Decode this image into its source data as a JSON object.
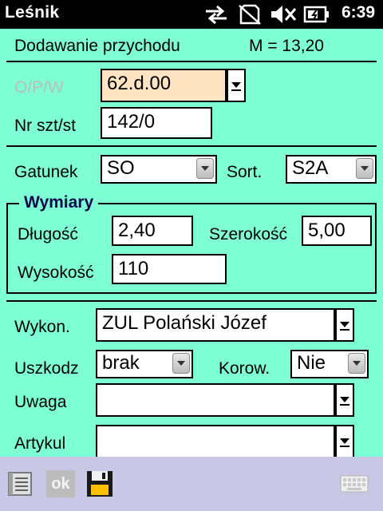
{
  "status_bar": {
    "app_title": "Leśnik",
    "time": "6:39",
    "icons": [
      "sync-arrows-icon",
      "no-sim-icon",
      "speaker-muted-icon",
      "battery-charging-icon"
    ]
  },
  "header": {
    "title": "Dodawanie przychodu",
    "measure": "M = 13,20"
  },
  "fields": {
    "opw": {
      "label": "O/P/W",
      "value": "62.d.00"
    },
    "nr": {
      "label": "Nr szt/st",
      "value": "142/0"
    },
    "gatunek": {
      "label": "Gatunek",
      "value": "SO"
    },
    "sort": {
      "label": "Sort.",
      "value": "S2A"
    },
    "wymiary": {
      "title": "Wymiary",
      "dlugosc": {
        "label": "Długość",
        "value": "2,40"
      },
      "szerokosc": {
        "label": "Szerokość",
        "value": "5,00"
      },
      "wysokosc": {
        "label": "Wysokość",
        "value": "110"
      }
    },
    "wykon": {
      "label": "Wykon.",
      "value": "ZUL Polański Józef"
    },
    "uszkodz": {
      "label": "Uszkodz",
      "value": "brak"
    },
    "korow": {
      "label": "Korow.",
      "value": "Nie"
    },
    "uwaga": {
      "label": "Uwaga",
      "value": ""
    },
    "artykul": {
      "label": "Artykul",
      "value": ""
    }
  },
  "toolbar": {
    "ok_label": "ok",
    "icons": [
      "list-icon",
      "ok-icon",
      "save-disk-icon",
      "keyboard-icon"
    ]
  },
  "colors": {
    "background": "#7fffd4",
    "focused_field": "#ffe4c4",
    "bottom_bar": "#c8c8e6",
    "status_bar": "#000000"
  }
}
